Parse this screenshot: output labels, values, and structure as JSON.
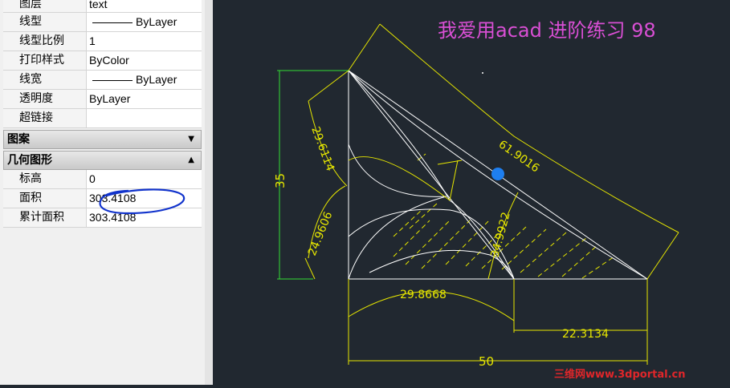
{
  "properties": {
    "rows_top": [
      {
        "label": "图层",
        "value": "text",
        "type": "text"
      },
      {
        "label": "线型",
        "value": "ByLayer",
        "type": "line"
      },
      {
        "label": "线型比例",
        "value": "1",
        "type": "text"
      },
      {
        "label": "打印样式",
        "value": "ByColor",
        "type": "text"
      },
      {
        "label": "线宽",
        "value": "ByLayer",
        "type": "line"
      },
      {
        "label": "透明度",
        "value": "ByLayer",
        "type": "text"
      },
      {
        "label": "超链接",
        "value": "",
        "type": "text"
      }
    ],
    "section_pattern": "图案",
    "section_geometry": "几何图形",
    "rows_geometry": [
      {
        "label": "标高",
        "value": "0"
      },
      {
        "label": "面积",
        "value": "303.4108"
      },
      {
        "label": "累计面积",
        "value": "303.4108"
      }
    ]
  },
  "drawing": {
    "title": "我爱用acad  进阶练习 98",
    "dims": {
      "d_35": "35",
      "d_29_6114": "29.6114",
      "d_24_9606": "24.9606",
      "d_61_9016": "61.9016",
      "d_34_9922": "34.9922",
      "d_29_8668": "29.8668",
      "d_22_3134": "22.3134",
      "d_50": "50"
    },
    "watermark": "三维网www.3dportal.cn",
    "colors": {
      "background": "#212830",
      "geometry": "#ffffff",
      "dimension": "#e6e600",
      "dim35": "#33dd33",
      "title": "#d94fd4",
      "grip": "#1e7ff0",
      "annotation_circle": "#1133cc",
      "watermark": "#e0262a"
    }
  }
}
